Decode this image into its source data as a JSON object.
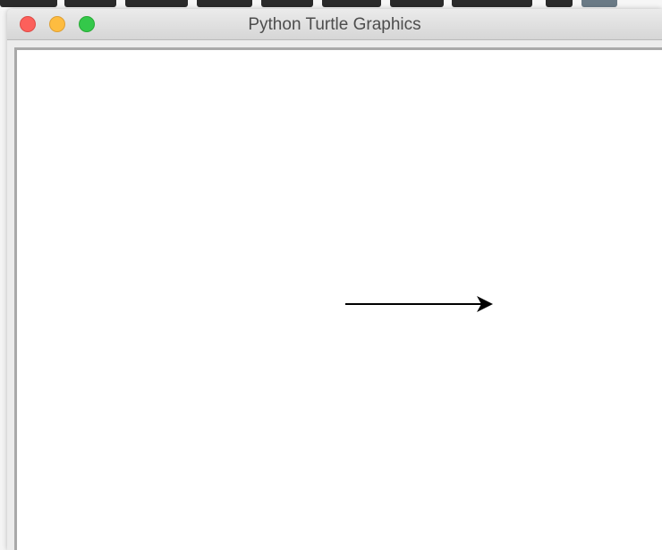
{
  "window": {
    "title": "Python Turtle Graphics",
    "traffic_lights": {
      "close": "#fc605b",
      "minimize": "#fdbc40",
      "zoom": "#34c84a"
    }
  },
  "canvas": {
    "background": "#ffffff",
    "turtle": {
      "shape": "arrow",
      "heading": "east",
      "pen_color": "#000000"
    }
  }
}
